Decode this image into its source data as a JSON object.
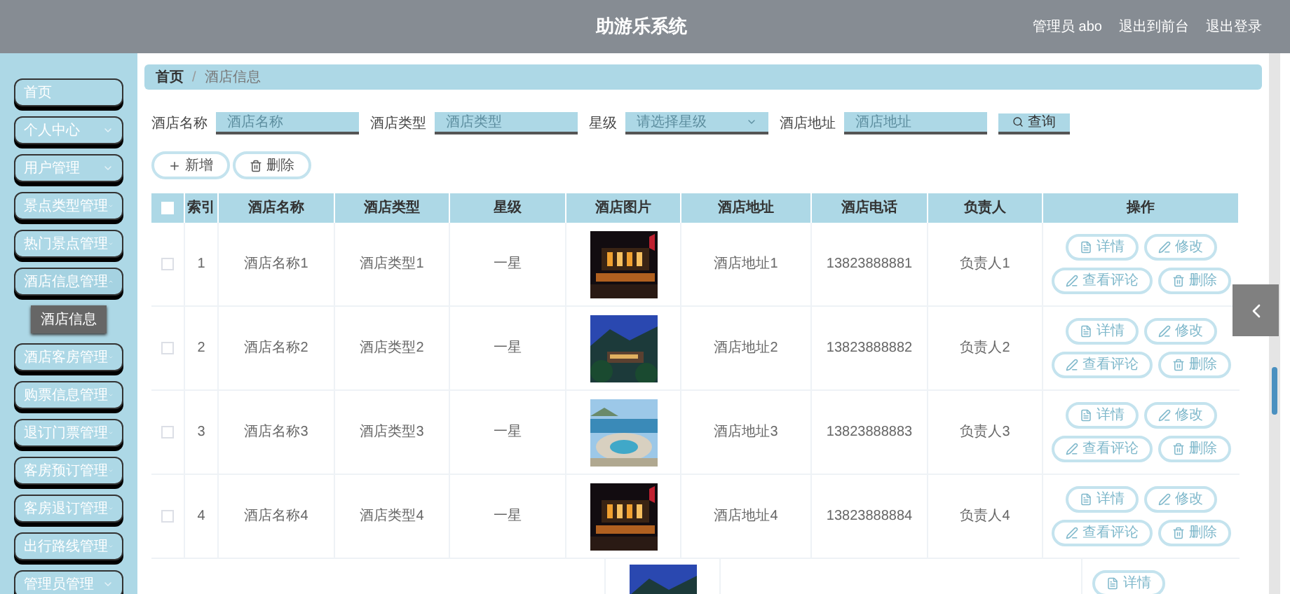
{
  "header": {
    "title": "助游乐系统",
    "user": "管理员 abo",
    "links": [
      "退出到前台",
      "退出登录"
    ]
  },
  "sidebar": {
    "items": [
      {
        "label": "首页",
        "kind": "link"
      },
      {
        "label": "个人中心",
        "kind": "menu",
        "expanded": false
      },
      {
        "label": "用户管理",
        "kind": "menu",
        "expanded": false
      },
      {
        "label": "景点类型管理",
        "kind": "menu",
        "expanded": false
      },
      {
        "label": "热门景点管理",
        "kind": "menu",
        "expanded": false
      },
      {
        "label": "酒店信息管理",
        "kind": "menu",
        "expanded": true,
        "children": [
          {
            "label": "酒店信息",
            "selected": true
          }
        ]
      },
      {
        "label": "酒店客房管理",
        "kind": "menu",
        "expanded": false
      },
      {
        "label": "购票信息管理",
        "kind": "menu",
        "expanded": false
      },
      {
        "label": "退订门票管理",
        "kind": "menu",
        "expanded": false
      },
      {
        "label": "客房预订管理",
        "kind": "menu",
        "expanded": false
      },
      {
        "label": "客房退订管理",
        "kind": "menu",
        "expanded": false
      },
      {
        "label": "出行路线管理",
        "kind": "menu",
        "expanded": false
      },
      {
        "label": "管理员管理",
        "kind": "menu",
        "expanded": false
      }
    ]
  },
  "breadcrumb": {
    "items": [
      "首页",
      "酒店信息"
    ],
    "separator": "/"
  },
  "search": {
    "fields": [
      {
        "label": "酒店名称",
        "placeholder": "酒店名称",
        "kind": "text"
      },
      {
        "label": "酒店类型",
        "placeholder": "酒店类型",
        "kind": "text"
      },
      {
        "label": "星级",
        "placeholder": "请选择星级",
        "kind": "select"
      },
      {
        "label": "酒店地址",
        "placeholder": "酒店地址",
        "kind": "text"
      }
    ],
    "button": "查询"
  },
  "actions": [
    {
      "label": "新增",
      "kind": "add"
    },
    {
      "label": "删除",
      "kind": "delete"
    }
  ],
  "table": {
    "header_checked": false,
    "columns": [
      "索引",
      "酒店名称",
      "酒店类型",
      "星级",
      "酒店图片",
      "酒店地址",
      "酒店电话",
      "负责人",
      "操作"
    ],
    "rows": [
      {
        "checked": false,
        "index": "1",
        "name": "酒店名称1",
        "type": "酒店类型1",
        "rating": "一星",
        "address": "酒店地址1",
        "phone": "13823888881",
        "manager": "负责人1",
        "actions": [
          {
            "label": "详情",
            "kind": "detail"
          },
          {
            "label": "修改",
            "kind": "edit"
          },
          {
            "label": "查看评论",
            "kind": "edit"
          },
          {
            "label": "删除",
            "kind": "delete"
          }
        ]
      },
      {
        "checked": false,
        "index": "2",
        "name": "酒店名称2",
        "type": "酒店类型2",
        "rating": "一星",
        "address": "酒店地址2",
        "phone": "13823888882",
        "manager": "负责人2",
        "actions": [
          {
            "label": "详情",
            "kind": "detail"
          },
          {
            "label": "修改",
            "kind": "edit"
          },
          {
            "label": "查看评论",
            "kind": "edit"
          },
          {
            "label": "删除",
            "kind": "delete"
          }
        ]
      },
      {
        "checked": false,
        "index": "3",
        "name": "酒店名称3",
        "type": "酒店类型3",
        "rating": "一星",
        "address": "酒店地址3",
        "phone": "13823888883",
        "manager": "负责人3",
        "actions": [
          {
            "label": "详情",
            "kind": "detail"
          },
          {
            "label": "修改",
            "kind": "edit"
          },
          {
            "label": "查看评论",
            "kind": "edit"
          },
          {
            "label": "删除",
            "kind": "delete"
          }
        ]
      },
      {
        "checked": false,
        "index": "4",
        "name": "酒店名称4",
        "type": "酒店类型4",
        "rating": "一星",
        "address": "酒店地址4",
        "phone": "13823888884",
        "manager": "负责人4",
        "actions": [
          {
            "label": "详情",
            "kind": "detail"
          },
          {
            "label": "修改",
            "kind": "edit"
          },
          {
            "label": "查看评论",
            "kind": "edit"
          },
          {
            "label": "删除",
            "kind": "delete"
          }
        ]
      }
    ],
    "partial_row": {
      "actions": [
        {
          "label": "详情",
          "kind": "detail"
        }
      ]
    }
  }
}
